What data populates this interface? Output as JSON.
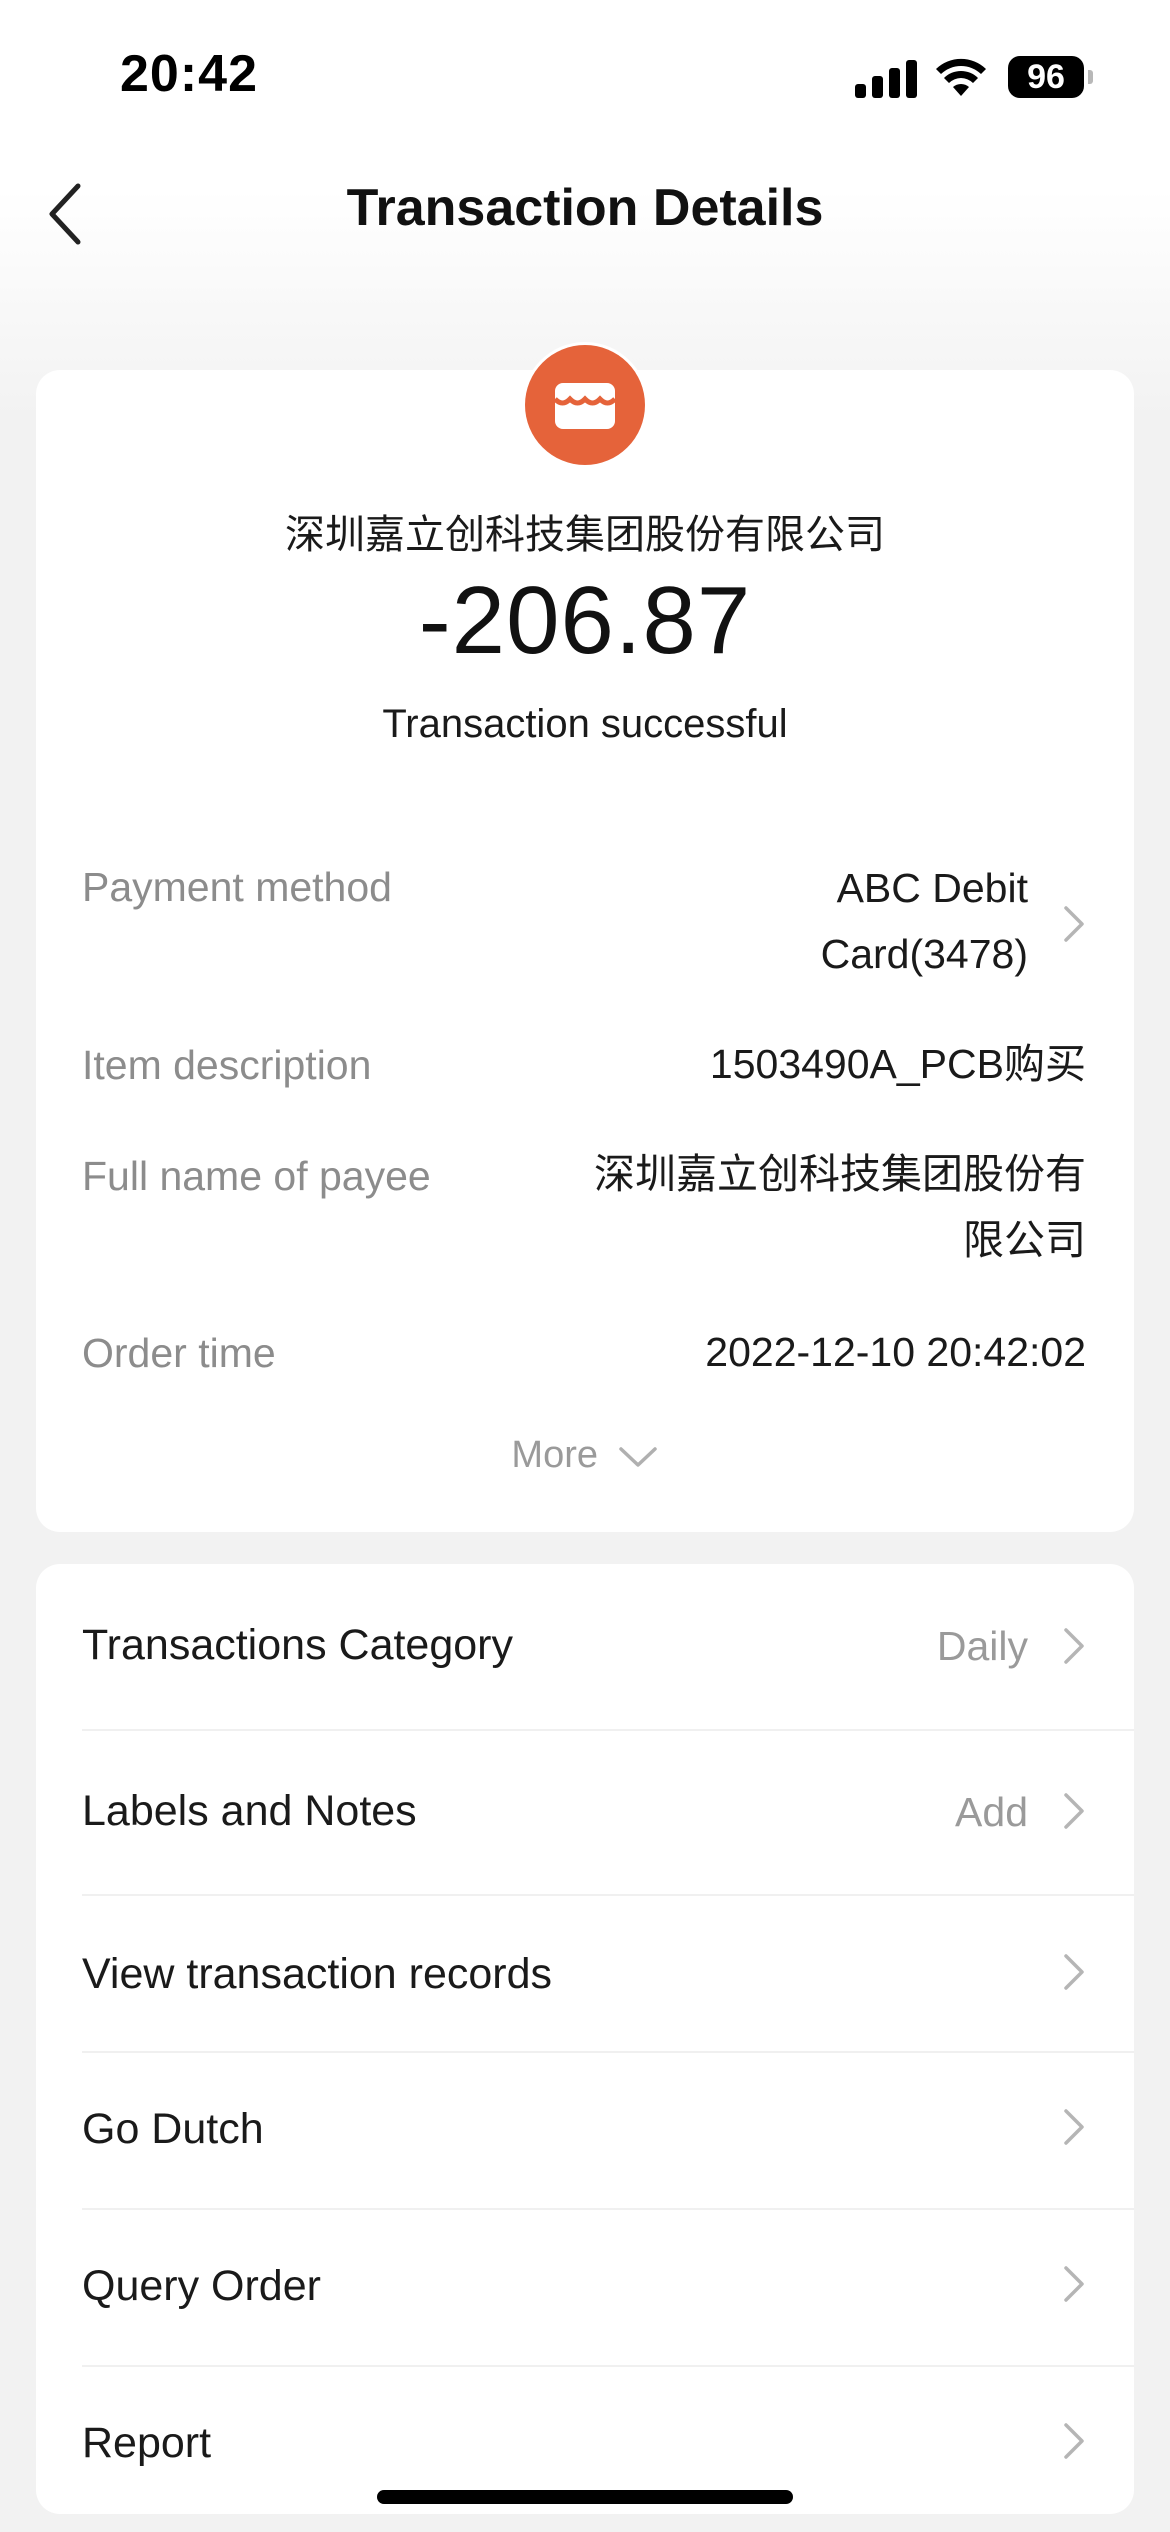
{
  "status_bar": {
    "time": "20:42",
    "battery": "96",
    "icons": [
      "signal-icon",
      "wifi-icon",
      "battery-icon"
    ]
  },
  "nav": {
    "title": "Transaction Details",
    "back_icon": "back-chevron-icon"
  },
  "summary": {
    "merchant_icon": "store-icon",
    "merchant": "深圳嘉立创科技集团股份有限公司",
    "amount": "-206.87",
    "status": "Transaction successful"
  },
  "details": {
    "payment_method_label": "Payment method",
    "payment_method_value": "ABC Debit Card(3478)",
    "item_description_label": "Item description",
    "item_description_value": "1503490A_PCB购买",
    "payee_label": "Full name of payee",
    "payee_value": "深圳嘉立创科技集团股份有限公司",
    "order_time_label": "Order time",
    "order_time_value": "2022-12-10 20:42:02",
    "more": "More"
  },
  "menu": {
    "items": [
      {
        "label": "Transactions Category",
        "value": "Daily"
      },
      {
        "label": "Labels and Notes",
        "value": "Add"
      },
      {
        "label": "View transaction records",
        "value": ""
      },
      {
        "label": "Go Dutch",
        "value": ""
      },
      {
        "label": "Query Order",
        "value": ""
      },
      {
        "label": "Report",
        "value": ""
      }
    ]
  },
  "colors": {
    "accent": "#e5633a",
    "background": "#f2f2f2",
    "card": "#ffffff",
    "secondary_text": "#8c8c8c"
  }
}
